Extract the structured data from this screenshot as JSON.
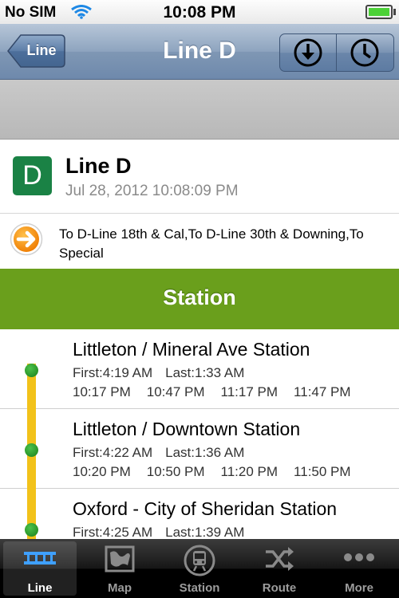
{
  "status_bar": {
    "carrier": "No SIM",
    "time": "10:08 PM"
  },
  "nav": {
    "back_label": "Line",
    "title": "Line D"
  },
  "line": {
    "badge": "D",
    "name": "Line D",
    "timestamp": "Jul 28, 2012 10:08:09 PM",
    "badge_color": "#1a8245"
  },
  "destinations": "To D-Line 18th & Cal,To D-Line 30th & Downing,To Special",
  "section_header": "Station",
  "stations": [
    {
      "name": "Littleton / Mineral Ave Station",
      "first": "First:4:19 AM",
      "last": "Last:1:33 AM",
      "times": [
        "10:17 PM",
        "10:47 PM",
        "11:17 PM",
        "11:47 PM"
      ]
    },
    {
      "name": "Littleton / Downtown Station",
      "first": "First:4:22 AM",
      "last": "Last:1:36 AM",
      "times": [
        "10:20 PM",
        "10:50 PM",
        "11:20 PM",
        "11:50 PM"
      ]
    },
    {
      "name": "Oxford - City of Sheridan Station",
      "first": "First:4:25 AM",
      "last": "Last:1:39 AM",
      "times": []
    }
  ],
  "tabs": [
    {
      "label": "Line",
      "icon": "line-icon",
      "active": true
    },
    {
      "label": "Map",
      "icon": "map-icon",
      "active": false
    },
    {
      "label": "Station",
      "icon": "train-icon",
      "active": false
    },
    {
      "label": "Route",
      "icon": "shuffle-icon",
      "active": false
    },
    {
      "label": "More",
      "icon": "more-icon",
      "active": false
    }
  ],
  "colors": {
    "accent_green": "#6a9f1c",
    "track_yellow": "#f2c21a",
    "nav_blue": "#8ea4bf"
  }
}
